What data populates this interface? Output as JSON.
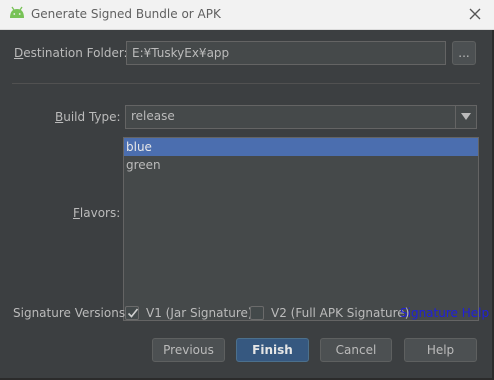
{
  "window": {
    "title": "Generate Signed Bundle or APK"
  },
  "destination": {
    "label_mnemonic": "D",
    "label_rest": "estination Folder:",
    "value": "E:¥TuskyEx¥app",
    "browse_label": "..."
  },
  "build_type": {
    "label_mnemonic": "B",
    "label_rest": "uild Type:",
    "selected": "release"
  },
  "flavors": {
    "label_mnemonic": "F",
    "label_rest": "lavors:",
    "items": [
      {
        "label": "blue",
        "selected": true
      },
      {
        "label": "green",
        "selected": false
      }
    ]
  },
  "signature": {
    "label": "Signature Versions:",
    "v1": {
      "label": "V1 (Jar Signature)",
      "checked": true
    },
    "v2": {
      "label": "V2 (Full APK Signature)",
      "checked": false
    },
    "help_link": "Signature Help"
  },
  "buttons": {
    "previous": "Previous",
    "finish": "Finish",
    "cancel": "Cancel",
    "help": "Help"
  },
  "colors": {
    "background": "#3c3f41",
    "selection": "#4b6eaf",
    "default_button": "#365880",
    "link": "#2020d8",
    "android": "#78c257"
  }
}
